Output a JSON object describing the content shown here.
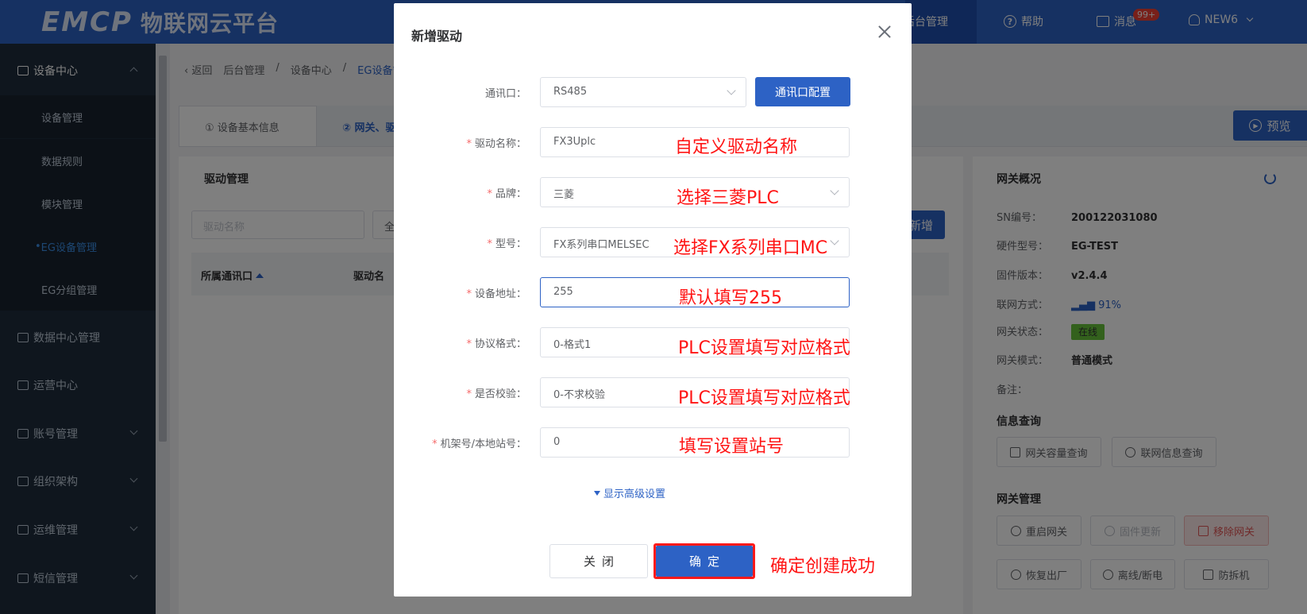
{
  "header": {
    "logo_mark": "EMCP",
    "logo_text": "物联网云平台",
    "nav_admin": "后台管理",
    "nav_help": "帮助",
    "nav_messages": "消息",
    "messages_badge": "99+",
    "user_name": "NEW6"
  },
  "sidebar": {
    "device_center": "设备中心",
    "sub_items": [
      "设备管理",
      "数据规则",
      "模块管理",
      "EG设备管理",
      "EG分组管理"
    ],
    "groups": [
      "数据中心管理",
      "运营中心",
      "账号管理",
      "组织架构",
      "运维管理",
      "短信管理"
    ]
  },
  "breadcrumb": {
    "back": "返回",
    "items": [
      "后台管理",
      "设备中心",
      "EG设备管"
    ]
  },
  "tabs": [
    "① 设备基本信息",
    "② 网关、驱"
  ],
  "preview_label": "预览",
  "driver_panel": {
    "title": "驱动管理",
    "search_placeholder": "驱动名称",
    "filter_value": "全",
    "add_label": "新增",
    "col_port": "所属通讯口",
    "col_name": "驱动名"
  },
  "gateway_panel": {
    "title": "网关概况",
    "sn_label": "SN编号：",
    "sn_value": "200122031080",
    "hw_label": "硬件型号：",
    "hw_value": "EG-TEST",
    "fw_label": "固件版本：",
    "fw_value": "v2.4.4",
    "net_label": "联网方式：",
    "net_value": "91%",
    "status_label": "网关状态：",
    "status_value": "在线",
    "mode_label": "网关模式：",
    "mode_value": "普通模式",
    "remark_label": "备注：",
    "info_section": "信息查询",
    "capacity_btn": "网关容量查询",
    "network_btn": "联网信息查询",
    "manage_section": "网关管理",
    "restart_btn": "重启网关",
    "firmware_btn": "固件更新",
    "remove_btn": "移除网关",
    "factory_btn": "恢复出厂",
    "offline_btn": "离线/断电",
    "tamper_btn": "防拆机"
  },
  "dialog": {
    "title": "新增驱动",
    "port_label": "通讯口：",
    "port_value": "RS485",
    "port_config_btn": "通讯口配置",
    "name_label": "驱动名称：",
    "name_value": "FX3Uplc",
    "brand_label": "品牌：",
    "brand_value": "三菱",
    "model_label": "型号：",
    "model_value": "FX系列串口MELSEC",
    "address_label": "设备地址：",
    "address_value": "255",
    "protocol_label": "协议格式：",
    "protocol_value": "0-格式1",
    "checksum_label": "是否校验：",
    "checksum_value": "0-不求校验",
    "station_label": "机架号/本地站号：",
    "station_value": "0",
    "advanced_link": "显示高级设置",
    "close_btn": "关闭",
    "ok_btn": "确定"
  },
  "annotations": {
    "name": "自定义驱动名称",
    "brand": "选择三菱PLC",
    "model": "选择FX系列串口MC",
    "address": "默认填写255",
    "protocol": "PLC设置填写对应格式",
    "checksum": "PLC设置填写对应格式",
    "station": "填写设置站号",
    "ok": "确定创建成功"
  },
  "colors": {
    "primary": "#2d62c5",
    "annotation_red": "#ff1414",
    "sidebar_bg": "#1f2d3d",
    "online_green": "#67c23a"
  }
}
